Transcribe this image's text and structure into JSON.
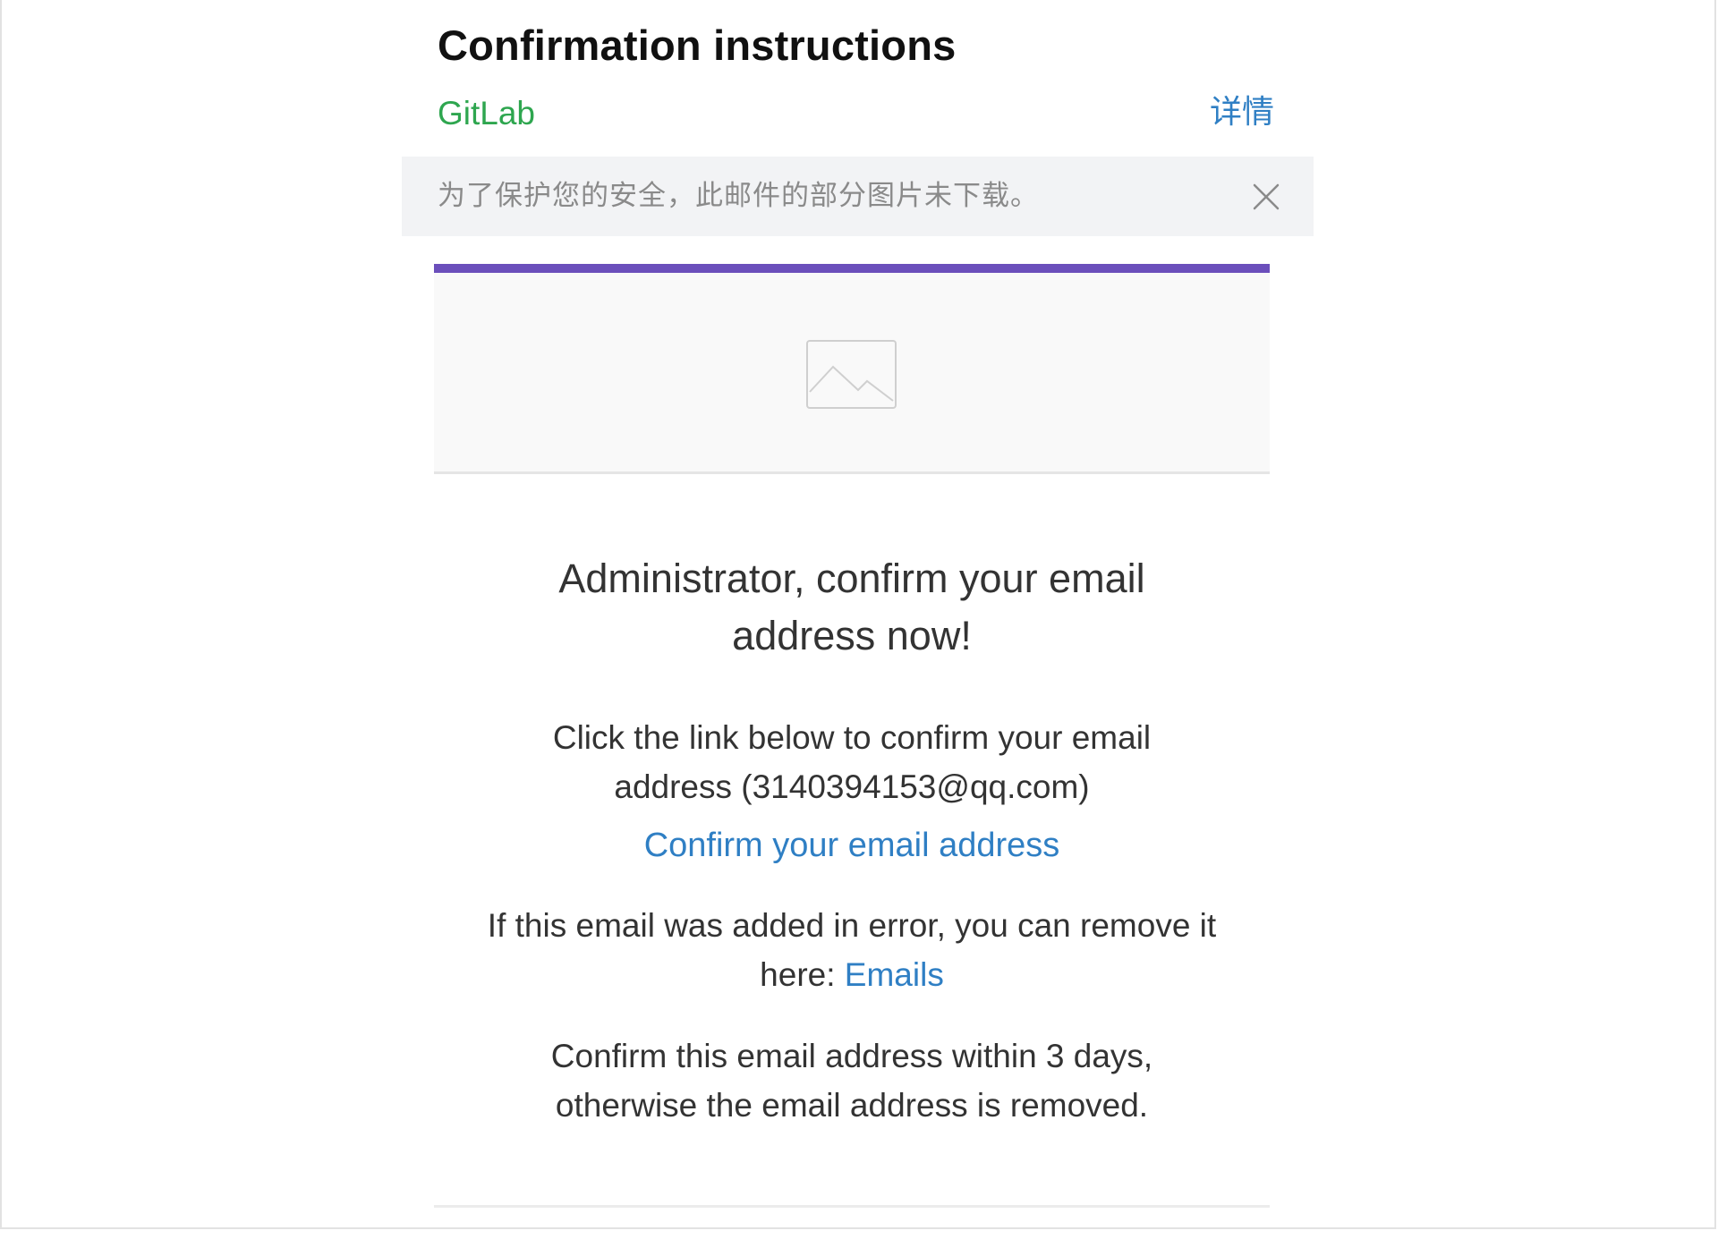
{
  "header": {
    "subject": "Confirmation instructions",
    "sender": "GitLab",
    "details_label": "详情"
  },
  "notice": {
    "text": "为了保护您的安全，此邮件的部分图片未下载。",
    "close_icon": "close-icon"
  },
  "email": {
    "accent_color": "#6b4fbb",
    "logo_placeholder_icon": "image-placeholder-icon",
    "headline": "Administrator, confirm your email address now!",
    "instruction": "Click the link below to confirm your email address (3140394153@qq.com)",
    "confirm_link": "Confirm your email address",
    "error_text": "If this email was added in error, you can remove it here:",
    "emails_link": "Emails",
    "expiry_text": "Confirm this email address within 3 days, otherwise the email address is removed."
  },
  "colors": {
    "link": "#2f7fc4",
    "sender": "#2ea64f",
    "notice_bg": "#f2f3f5"
  }
}
